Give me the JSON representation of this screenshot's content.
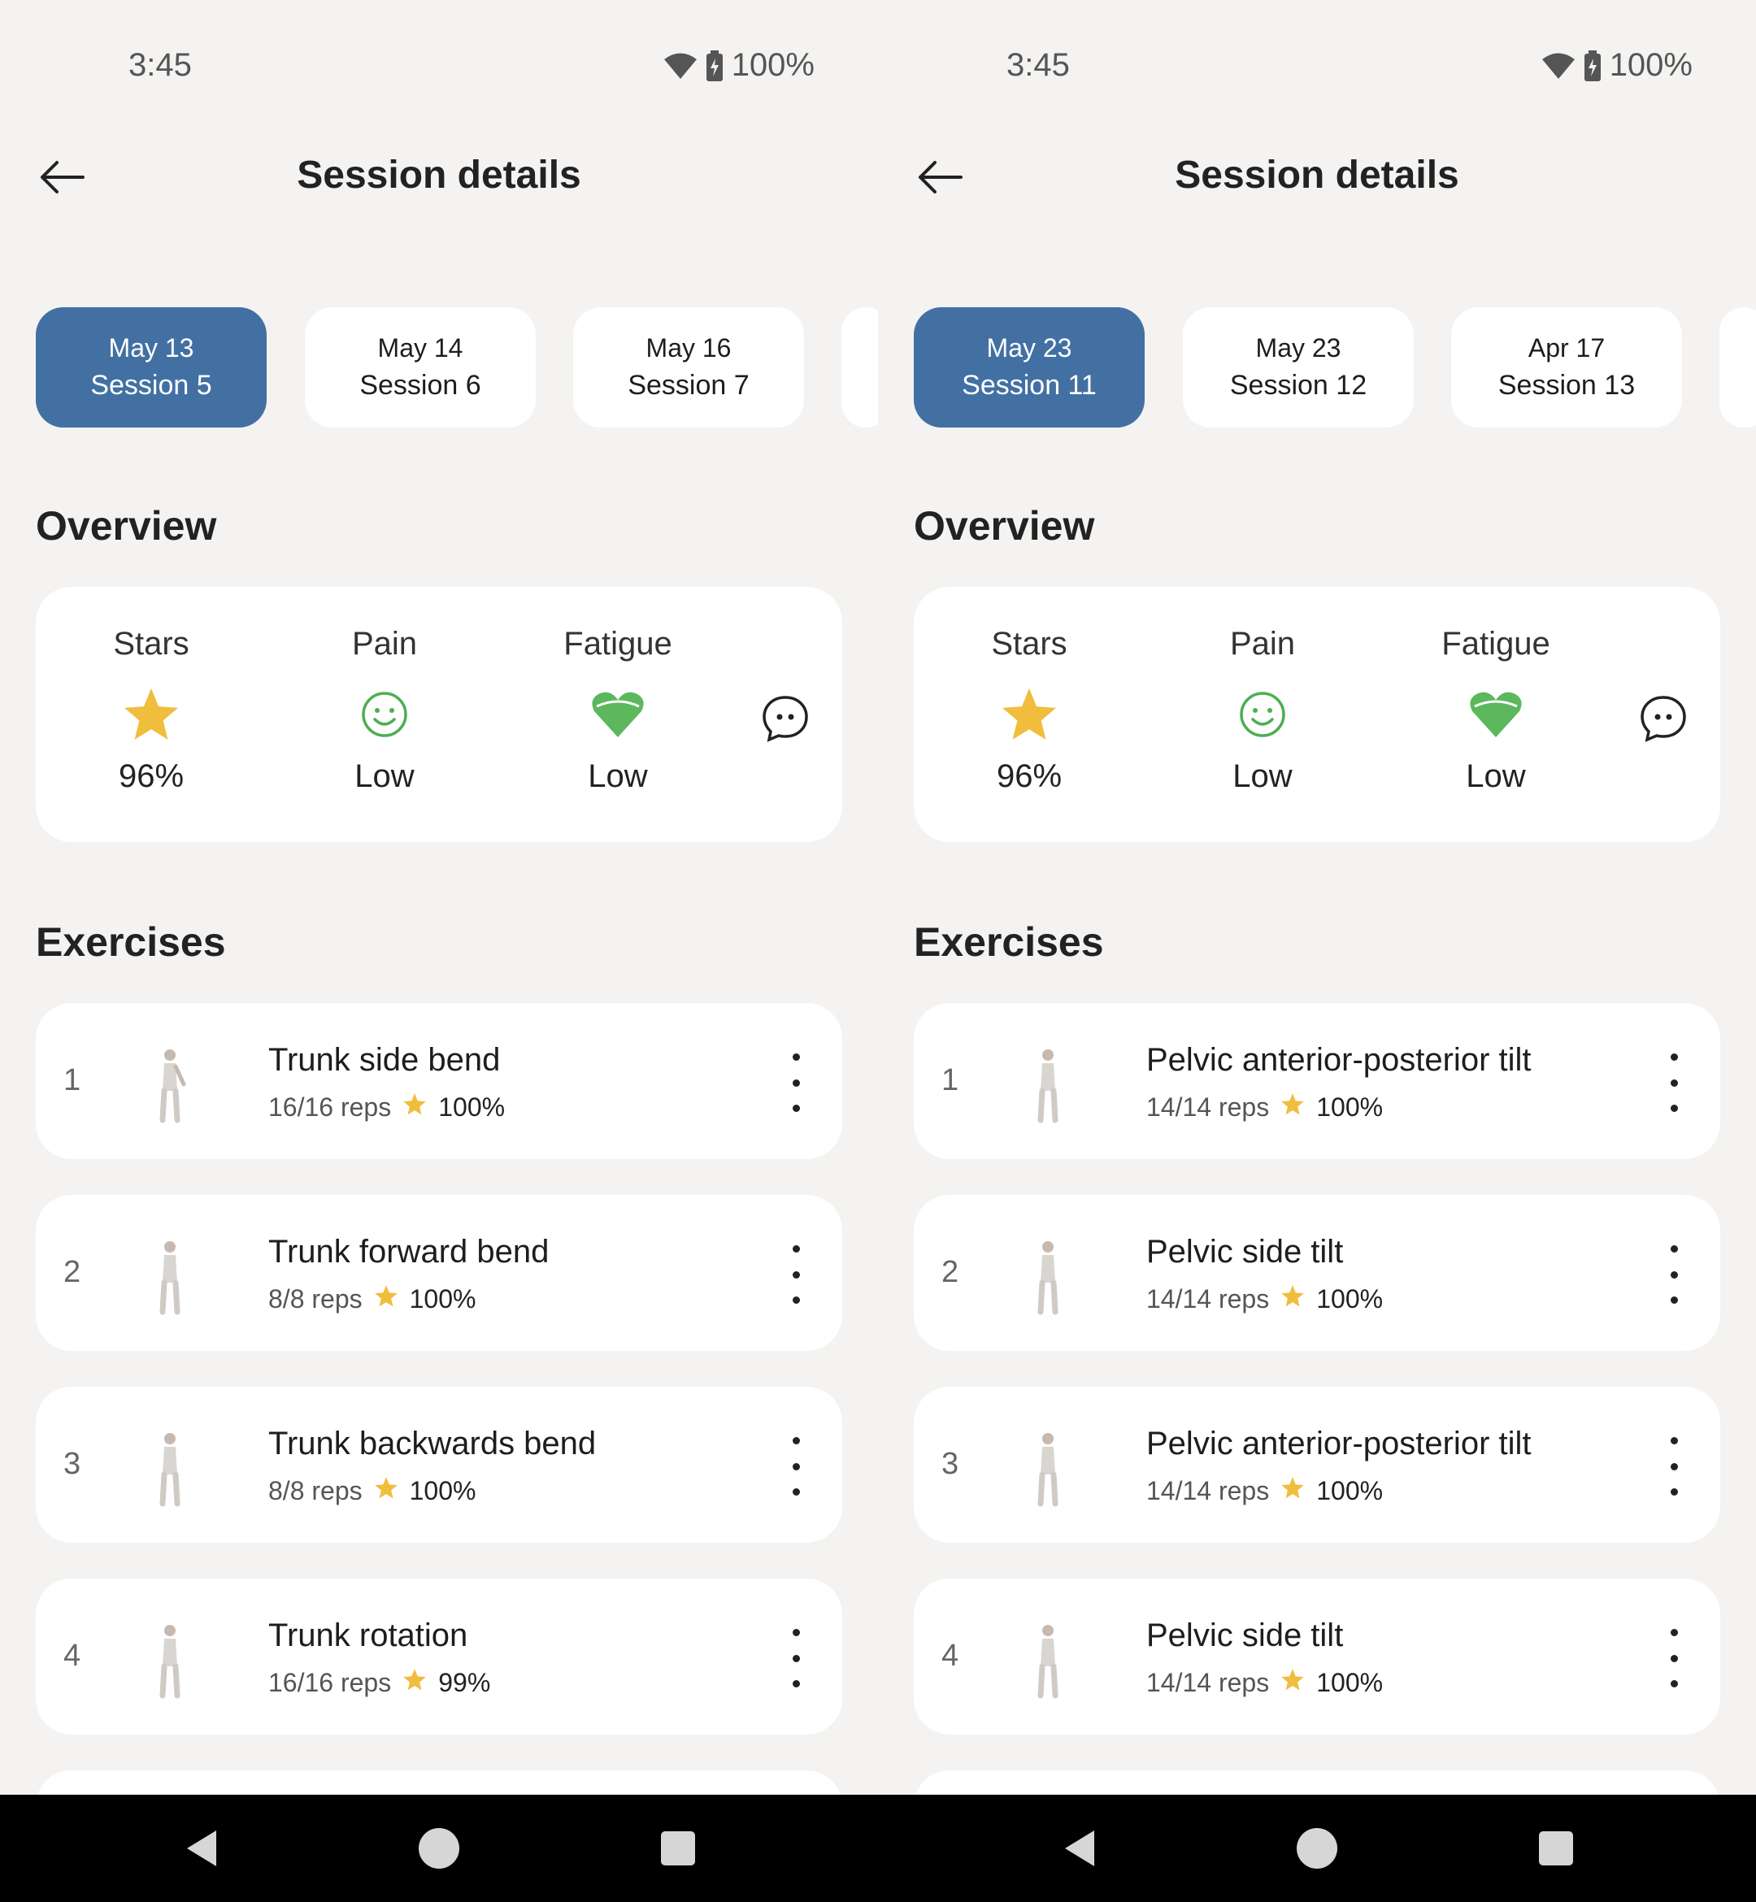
{
  "status_bar": {
    "time": "3:45",
    "battery": "100%"
  },
  "colors": {
    "accent": "#4270a3",
    "star": "#f0be3c",
    "pain_green": "#4caf50",
    "heart_green": "#5cb85c"
  },
  "icons": {
    "back": "arrow-left-icon",
    "wifi": "wifi-icon",
    "battery": "battery-charging-icon",
    "star": "star-icon",
    "pain": "smiley-face-icon",
    "fatigue": "heart-icon",
    "chat": "chat-bubble-icon",
    "more": "more-vertical-icon"
  },
  "panels": [
    {
      "title": "Session details",
      "sessions": [
        {
          "date": "May 13",
          "label": "Session 5",
          "active": true
        },
        {
          "date": "May 14",
          "label": "Session 6",
          "active": false
        },
        {
          "date": "May 16",
          "label": "Session 7",
          "active": false
        }
      ],
      "overview_title": "Overview",
      "overview": {
        "stars_label": "Stars",
        "stars_value": "96%",
        "pain_label": "Pain",
        "pain_value": "Low",
        "fatigue_label": "Fatigue",
        "fatigue_value": "Low"
      },
      "exercises_title": "Exercises",
      "exercises": [
        {
          "num": "1",
          "name": "Trunk side bend",
          "reps": "16/16 reps",
          "pct": "100%"
        },
        {
          "num": "2",
          "name": "Trunk forward bend",
          "reps": "8/8 reps",
          "pct": "100%"
        },
        {
          "num": "3",
          "name": "Trunk backwards bend",
          "reps": "8/8 reps",
          "pct": "100%"
        },
        {
          "num": "4",
          "name": "Trunk rotation",
          "reps": "16/16 reps",
          "pct": "99%"
        }
      ]
    },
    {
      "title": "Session details",
      "sessions": [
        {
          "date": "May 23",
          "label": "Session 11",
          "active": true
        },
        {
          "date": "May 23",
          "label": "Session 12",
          "active": false
        },
        {
          "date": "Apr 17",
          "label": "Session 13",
          "active": false
        }
      ],
      "overview_title": "Overview",
      "overview": {
        "stars_label": "Stars",
        "stars_value": "96%",
        "pain_label": "Pain",
        "pain_value": "Low",
        "fatigue_label": "Fatigue",
        "fatigue_value": "Low"
      },
      "exercises_title": "Exercises",
      "exercises": [
        {
          "num": "1",
          "name": "Pelvic anterior-posterior tilt",
          "reps": "14/14 reps",
          "pct": "100%"
        },
        {
          "num": "2",
          "name": "Pelvic side tilt",
          "reps": "14/14 reps",
          "pct": "100%"
        },
        {
          "num": "3",
          "name": "Pelvic anterior-posterior tilt",
          "reps": "14/14 reps",
          "pct": "100%"
        },
        {
          "num": "4",
          "name": "Pelvic side tilt",
          "reps": "14/14 reps",
          "pct": "100%"
        }
      ]
    }
  ]
}
